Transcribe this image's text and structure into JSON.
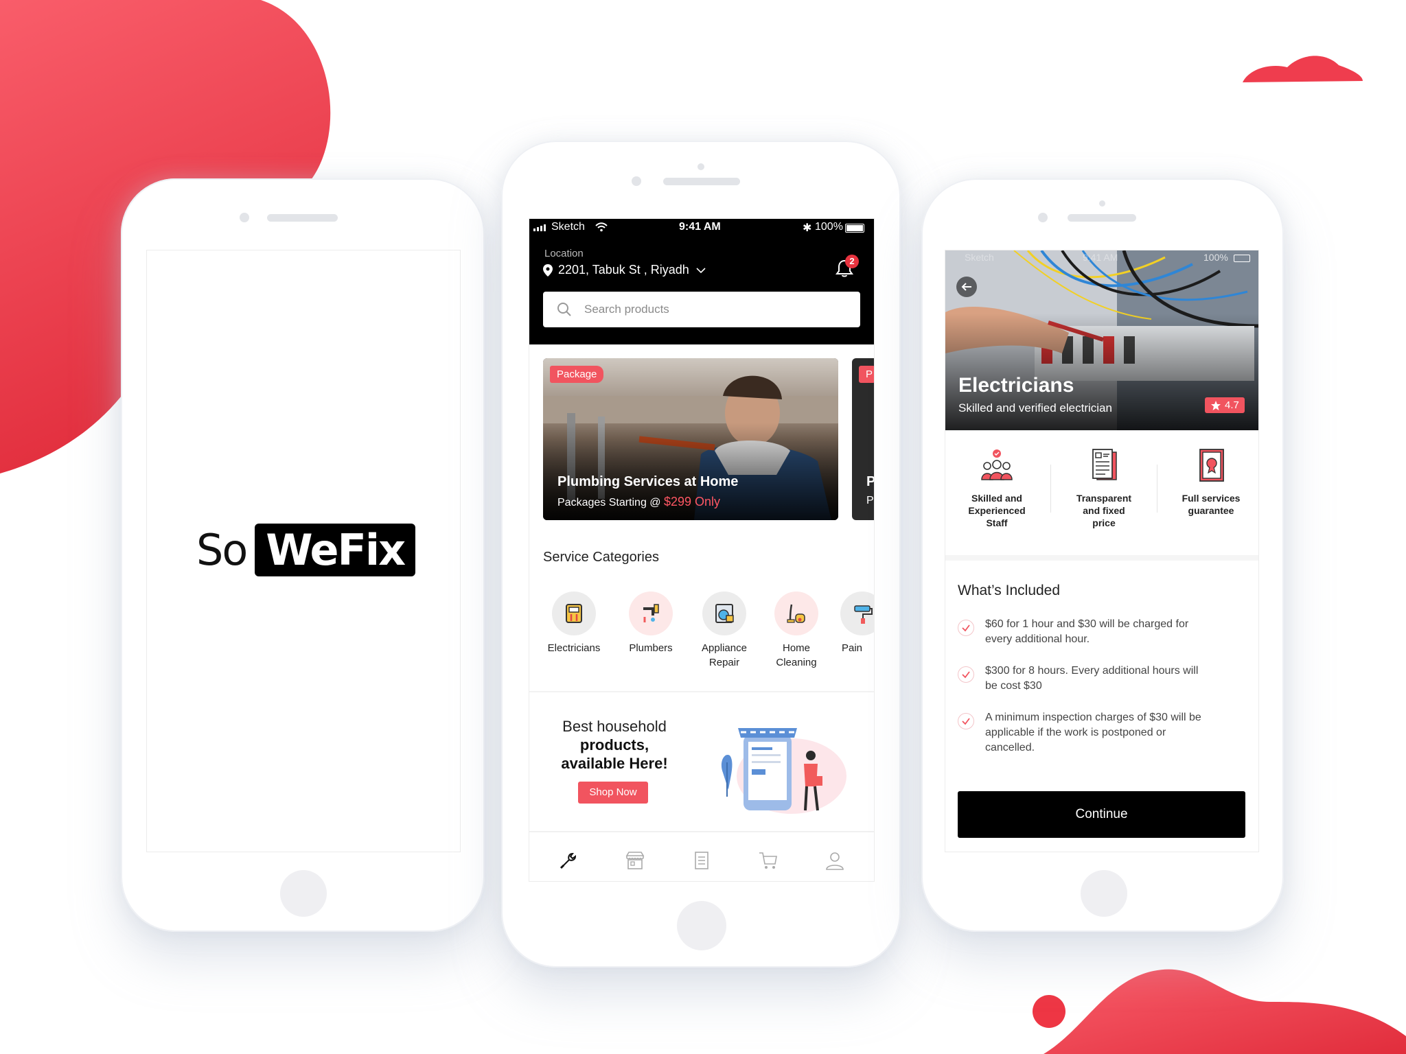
{
  "brand": {
    "so": "So",
    "wefix": "WeFix",
    "accent": "#f1545f"
  },
  "status_bar": {
    "carrier": "Sketch",
    "time": "9:41 AM",
    "battery": "100%"
  },
  "home": {
    "location_label": "Location",
    "location_value": "2201, Tabuk St , Riyadh",
    "notification_count": "2",
    "search_placeholder": "Search products",
    "promo": {
      "tag": "Package",
      "title": "Plumbing Services at Home",
      "subtitle": "Packages Starting @ ",
      "price": "$299 Only",
      "next_tag": "P",
      "next_title": "P",
      "next_sub": "P"
    },
    "categories_title": "Service Categories",
    "categories": [
      {
        "l1": "Electricians",
        "l2": "",
        "icon": "electric-meter-icon"
      },
      {
        "l1": "Plumbers",
        "l2": "",
        "icon": "pipe-faucet-icon"
      },
      {
        "l1": "Appliance",
        "l2": "Repair",
        "icon": "washing-machine-icon"
      },
      {
        "l1": "Home",
        "l2": "Cleaning",
        "icon": "vacuum-cleaner-icon"
      },
      {
        "l1": "Pain",
        "l2": "",
        "icon": "paint-roller-icon"
      }
    ],
    "banner": {
      "line1": "Best household",
      "line2": "products,",
      "line3": "available Here!",
      "button": "Shop Now"
    },
    "tabs": [
      "wrench-icon",
      "store-icon",
      "list-icon",
      "cart-icon",
      "user-icon"
    ]
  },
  "detail": {
    "title": "Electricians",
    "subtitle": "Skilled and verified electrician",
    "rating": "4.7",
    "features": [
      {
        "lines": [
          "Skilled and",
          "Experienced",
          "Staff"
        ],
        "icon": "team-icon"
      },
      {
        "lines": [
          "Transparent",
          "and fixed",
          "price"
        ],
        "icon": "invoice-icon"
      },
      {
        "lines": [
          "Full services",
          "guarantee"
        ],
        "icon": "certificate-icon"
      }
    ],
    "included_title": "What’s Included",
    "included": [
      {
        "a": "$60 for 1 hour and $30 will be  charged for",
        "b": "every additional hour.",
        "c": ""
      },
      {
        "a": "$300 for 8 hours. Every additional hours will",
        "b": "be cost $30",
        "c": ""
      },
      {
        "a": "A minimum inspection charges of $30 will be",
        "b": "applicable if the work is postponed or",
        "c": "cancelled."
      }
    ],
    "continue": "Continue"
  }
}
